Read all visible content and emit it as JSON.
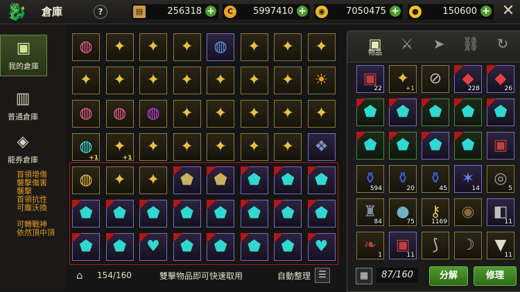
{
  "header": {
    "title": "倉庫",
    "help_icon": "?",
    "currencies": [
      {
        "icon": "scroll-icon",
        "value": "256318",
        "color": "#c89a4a"
      },
      {
        "icon": "c-coin-icon",
        "value": "5997410",
        "color": "#e8a52a"
      },
      {
        "icon": "gold-coin-icon",
        "value": "7050475",
        "color": "#e8b830"
      },
      {
        "icon": "yellow-coin-icon",
        "value": "150600",
        "color": "#f0c020"
      }
    ]
  },
  "sidebar": {
    "tabs": [
      {
        "label": "我的倉庫",
        "icon": "box-icon",
        "active": true
      },
      {
        "label": "普通倉庫",
        "icon": "building-icon",
        "active": false
      },
      {
        "label": "龍券倉庫",
        "icon": "c-ticket-icon",
        "active": false
      }
    ],
    "notes": [
      "首領增傷",
      "襲擊傷害",
      "襲擊",
      "首領抗性",
      "可龐沃換",
      "",
      "可轉戰神",
      "依然頂中頂"
    ]
  },
  "storage": {
    "capacity": "154/160",
    "hint": "雙擊物品即可快速取用",
    "auto_sort": "自動整理",
    "rows": [
      [
        "ring-pink",
        "earring",
        "earring",
        "earring",
        "ring-blue",
        "earring",
        "earring",
        "earring"
      ],
      [
        "earring",
        "earring",
        "earring",
        "earring",
        "earring",
        "earring",
        "earring",
        "lantern"
      ],
      [
        "ring-pink",
        "ring-pink",
        "ring-purple",
        "earring",
        "earring",
        "earring",
        "earring",
        "earring"
      ],
      [
        "ring-cyan+1",
        "earring+1",
        "earring",
        "earring",
        "earring",
        "earring",
        "earring",
        "dragon"
      ],
      [
        "ring-gold",
        "earring",
        "earring",
        "shield-gold",
        "shield-gold",
        "shield-teal",
        "shield-teal",
        "shield-teal"
      ],
      [
        "shield-teal",
        "shield-teal",
        "shield-teal",
        "shield-teal",
        "shield-teal",
        "shield-teal",
        "shield-teal",
        "shield-teal"
      ],
      [
        "shield-teal",
        "shield-teal",
        "shield-heart",
        "shield-teal",
        "shield-teal",
        "shield-teal",
        "shield-teal",
        "shield-heart"
      ]
    ]
  },
  "right_panel": {
    "tabs": [
      {
        "label": "物品",
        "icon": "box-icon",
        "active": true
      },
      {
        "label": "",
        "icon": "sword-icon",
        "active": false
      },
      {
        "label": "",
        "icon": "arrow-icon",
        "active": false
      },
      {
        "label": "",
        "icon": "link-icon",
        "active": false
      },
      {
        "label": "",
        "icon": "swirl-icon",
        "active": false
      }
    ],
    "items": [
      {
        "type": "chest",
        "count": "22"
      },
      {
        "type": "earring",
        "count": "+1"
      },
      {
        "type": "no",
        "count": ""
      },
      {
        "type": "gem",
        "count": "228"
      },
      {
        "type": "gem",
        "count": "26"
      },
      {
        "type": "shield",
        "count": ""
      },
      {
        "type": "shield",
        "count": ""
      },
      {
        "type": "shield",
        "count": ""
      },
      {
        "type": "shield",
        "count": ""
      },
      {
        "type": "shield",
        "count": ""
      },
      {
        "type": "shield",
        "count": ""
      },
      {
        "type": "shield",
        "count": ""
      },
      {
        "type": "shield",
        "count": ""
      },
      {
        "type": "shield",
        "count": ""
      },
      {
        "type": "chest",
        "count": ""
      },
      {
        "type": "potion",
        "count": "594"
      },
      {
        "type": "potion",
        "count": "20"
      },
      {
        "type": "potion",
        "count": "45"
      },
      {
        "type": "star",
        "count": "14"
      },
      {
        "type": "swirl",
        "count": "5"
      },
      {
        "type": "cloak",
        "count": "84"
      },
      {
        "type": "stones",
        "count": "75"
      },
      {
        "type": "key",
        "count": "1169"
      },
      {
        "type": "ball",
        "count": ""
      },
      {
        "type": "armor",
        "count": "11"
      },
      {
        "type": "feather",
        "count": "1"
      },
      {
        "type": "chest",
        "count": "11"
      },
      {
        "type": "claw",
        "count": ""
      },
      {
        "type": "horn",
        "count": ""
      },
      {
        "type": "tooth",
        "count": "11"
      }
    ],
    "inventory_count": "87/160",
    "split_label": "分解",
    "repair_label": "修理"
  }
}
